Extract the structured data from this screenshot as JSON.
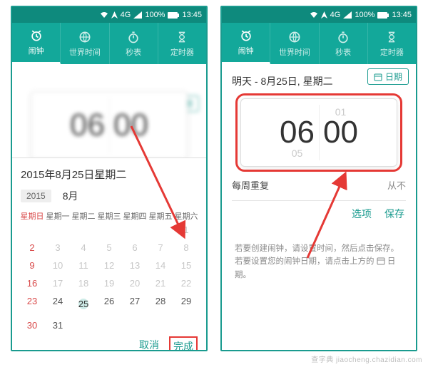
{
  "status": {
    "net_label": "4G",
    "battery": "100%",
    "time": "13:45"
  },
  "tabs": {
    "alarm": "闹钟",
    "world": "世界时间",
    "stopwatch": "秒表",
    "timer": "定时器"
  },
  "date_pill_label": "日期",
  "left": {
    "time_hour": "06",
    "time_min": "00",
    "sheet": {
      "title": "2015年8月25日星期二",
      "year": "2015",
      "month": "8月",
      "dow": [
        "星期日",
        "星期一",
        "星期二",
        "星期三",
        "星期四",
        "星期五",
        "星期六"
      ],
      "rows": [
        [
          "",
          "",
          "",
          "",
          "",
          "",
          "1"
        ],
        [
          "2",
          "3",
          "4",
          "5",
          "6",
          "7",
          "8"
        ],
        [
          "9",
          "10",
          "11",
          "12",
          "13",
          "14",
          "15"
        ],
        [
          "16",
          "17",
          "18",
          "19",
          "20",
          "21",
          "22"
        ],
        [
          "23",
          "24",
          "25",
          "26",
          "27",
          "28",
          "29"
        ],
        [
          "30",
          "31",
          "",
          "",
          "",
          "",
          ""
        ]
      ],
      "selected": "25",
      "cancel": "取消",
      "done": "完成"
    }
  },
  "right": {
    "subtitle": "明天 - 8月25日, 星期二",
    "ghost_top": "01",
    "hour": "06",
    "min": "00",
    "ghost_bot": "05",
    "repeat_label": "每周重复",
    "repeat_value": "从不",
    "options": "选项",
    "save": "保存",
    "hint_a": "若要创建闹钟，请设置时间，然后点击保存。若要设置您的闹钟日期，请点击上方的",
    "hint_b": "日期。"
  },
  "watermark": "查字典 jiaocheng.chazidian.com"
}
